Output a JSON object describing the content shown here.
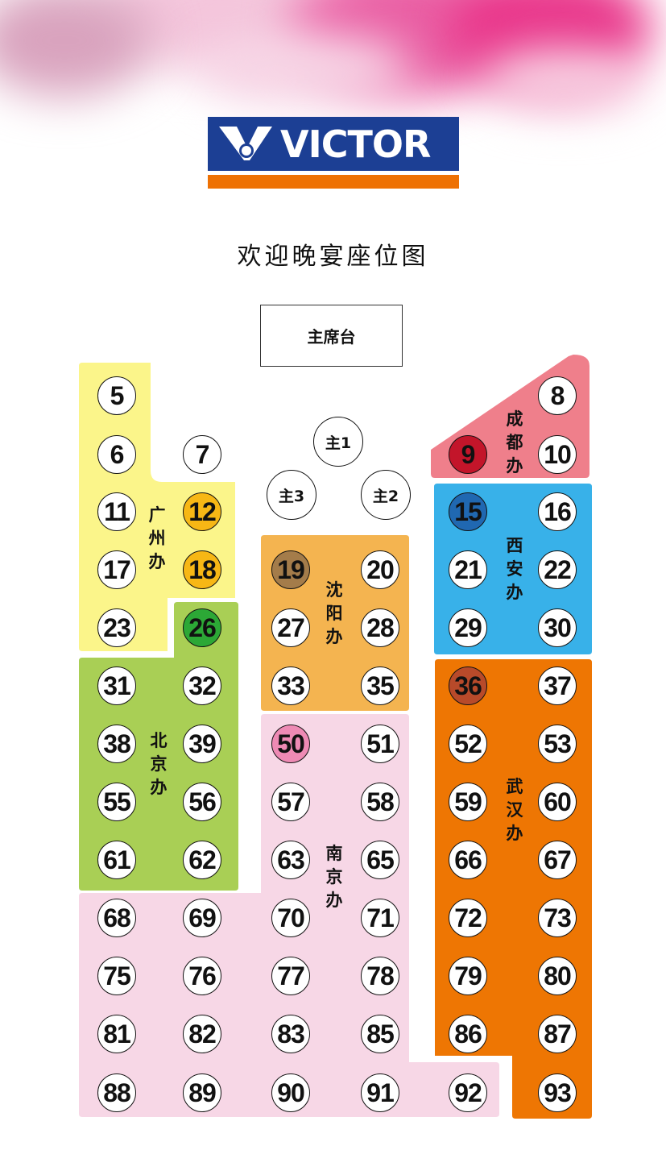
{
  "brand": {
    "logo_text": "VICTOR"
  },
  "title": "欢迎晚宴座位图",
  "stage_label": "主席台",
  "host_seats": [
    "主1",
    "主2",
    "主3"
  ],
  "offices": [
    {
      "id": "guangzhou",
      "name": "广州办",
      "color": "#fbf58a",
      "seats": [
        5,
        6,
        11,
        12,
        17,
        18,
        23
      ]
    },
    {
      "id": "beijing",
      "name": "北京办",
      "color": "#a9cf55",
      "seats": [
        26,
        31,
        32,
        38,
        39,
        55,
        56,
        61,
        62
      ]
    },
    {
      "id": "shenyang",
      "name": "沈阳办",
      "color": "#f4b450",
      "seats": [
        19,
        20,
        27,
        28,
        33,
        35
      ]
    },
    {
      "id": "nanjing",
      "name": "南京办",
      "color": "#f7d7e6",
      "seats": [
        50,
        51,
        57,
        58,
        63,
        65,
        68,
        69,
        70,
        71,
        75,
        76,
        77,
        78,
        81,
        82,
        83,
        85,
        88,
        89,
        90,
        91,
        92
      ]
    },
    {
      "id": "chengdu",
      "name": "成都办",
      "color": "#ef7f8b",
      "seats": [
        8,
        9,
        10
      ]
    },
    {
      "id": "xian",
      "name": "西安办",
      "color": "#38b1e9",
      "seats": [
        15,
        16,
        21,
        22,
        29,
        30
      ]
    },
    {
      "id": "wuhan",
      "name": "武汉办",
      "color": "#ee7603",
      "seats": [
        36,
        37,
        52,
        53,
        59,
        60,
        66,
        67,
        72,
        73,
        79,
        80,
        86,
        87,
        93
      ]
    }
  ],
  "unassigned_seats": [
    7
  ],
  "highlighted_seats": [
    {
      "seat": 12,
      "color": "#f7b715"
    },
    {
      "seat": 18,
      "color": "#f7b715"
    },
    {
      "seat": 26,
      "color": "#2ca836"
    },
    {
      "seat": 19,
      "color": "#a47c4a"
    },
    {
      "seat": 9,
      "color": "#c3152a"
    },
    {
      "seat": 15,
      "color": "#2068b1"
    },
    {
      "seat": 36,
      "color": "#b84a2a"
    },
    {
      "seat": 50,
      "color": "#ee8ab4"
    }
  ]
}
